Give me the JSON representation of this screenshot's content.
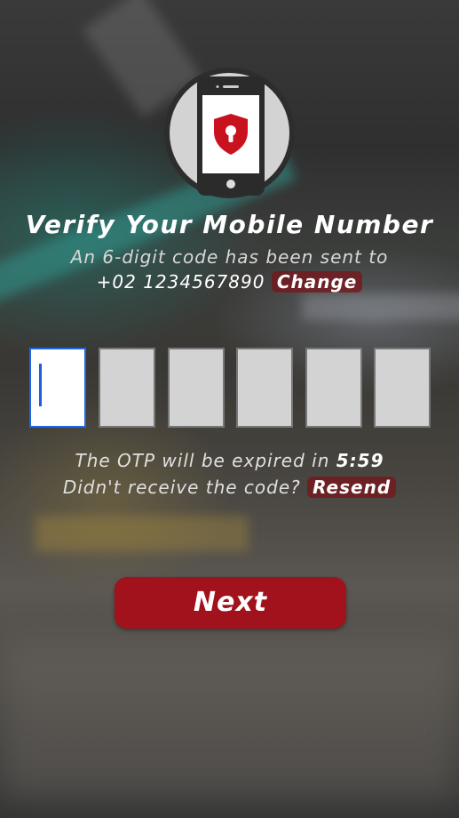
{
  "header": {
    "icon": "phone-lock-icon",
    "title": "Verify Your Mobile Number",
    "subtitle": "An 6-digit code has been sent to",
    "phone_number": "+02 1234567890",
    "change_label": "Change"
  },
  "otp": {
    "digits": [
      "",
      "",
      "",
      "",
      "",
      ""
    ],
    "active_index": 0
  },
  "timer": {
    "expire_text": "The OTP will be expired in",
    "time_left": "5:59"
  },
  "resend": {
    "prompt": "Didn't receive the code?",
    "label": "Resend"
  },
  "actions": {
    "next_label": "Next"
  },
  "colors": {
    "accent": "#a1121c",
    "active_border": "#1e66e8",
    "box_fill": "#d3d3d3"
  }
}
